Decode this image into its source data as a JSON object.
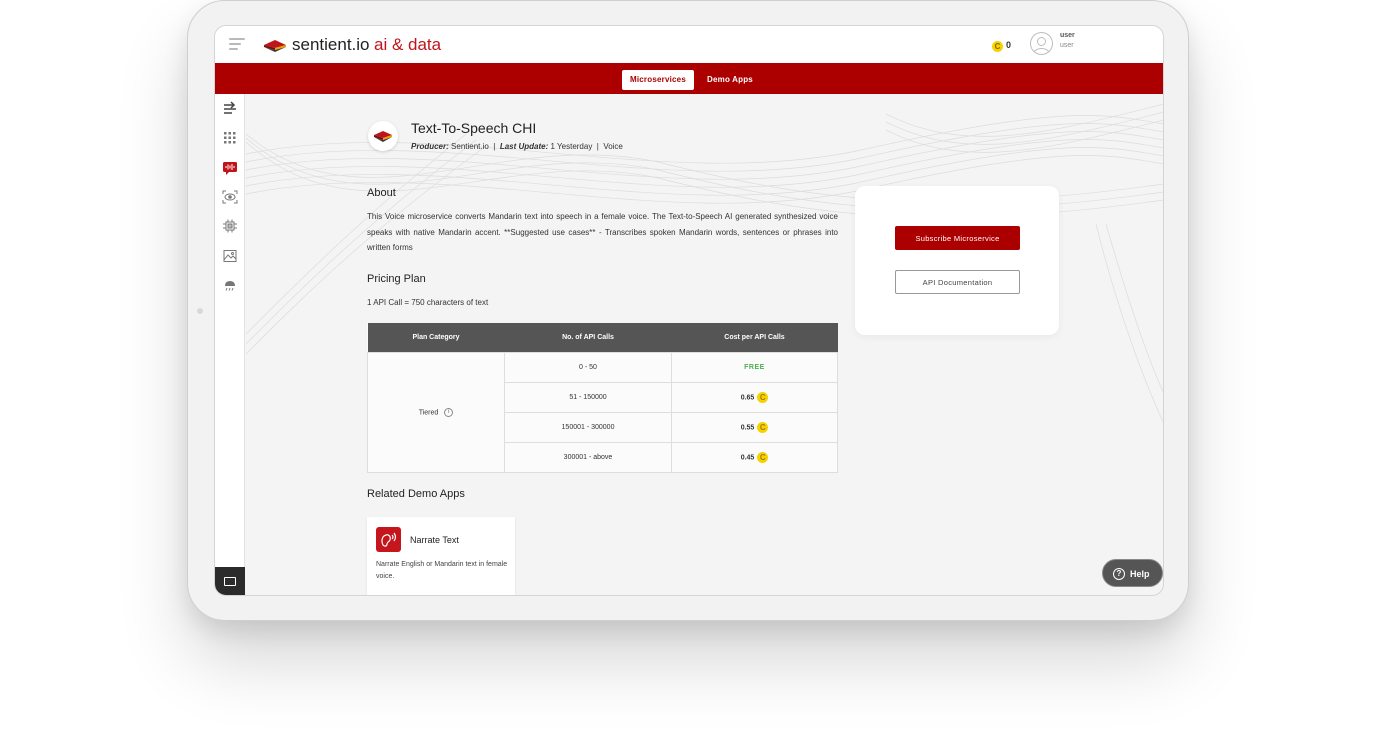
{
  "header": {
    "brand": "sentient.io",
    "brand_accent": "ai & data",
    "coin_balance": "0",
    "user_name": "user",
    "user_role": "user"
  },
  "nav": {
    "tabs": [
      {
        "label": "Microservices",
        "active": true
      },
      {
        "label": "Demo Apps",
        "active": false
      }
    ]
  },
  "sidebar": {
    "icons": [
      "collapse-arrow-icon",
      "grid-icon",
      "voice-icon",
      "vision-icon",
      "chip-icon",
      "image-icon",
      "weather-icon"
    ],
    "bottom_icon": "folder-icon"
  },
  "service": {
    "title": "Text-To-Speech CHI",
    "producer_label": "Producer:",
    "producer": "Sentient.io",
    "last_update_label": "Last Update:",
    "last_update": "1 Yesterday",
    "separator": "|",
    "category": "Voice"
  },
  "about": {
    "heading": "About",
    "text": "This Voice microservice converts Mandarin text into speech in a female voice. The Text-to-Speech AI generated synthesized voice speaks with native Mandarin accent. **Suggested use cases** - Transcribes spoken Mandarin words, sentences or phrases into written forms"
  },
  "pricing": {
    "heading": "Pricing Plan",
    "note": "1 API Call = 750 characters of text",
    "headers": [
      "Plan Category",
      "No. of API Calls",
      "Cost per API Calls"
    ],
    "category": "Tiered",
    "rows": [
      {
        "range": "0 - 50",
        "cost": "FREE",
        "coin": false
      },
      {
        "range": "51 - 150000",
        "cost": "0.65",
        "coin": true
      },
      {
        "range": "150001 - 300000",
        "cost": "0.55",
        "coin": true
      },
      {
        "range": "300001 - above",
        "cost": "0.45",
        "coin": true
      }
    ]
  },
  "related": {
    "heading": "Related Demo Apps",
    "apps": [
      {
        "title": "Narrate Text",
        "description": "Narrate English or Mandarin text in female voice."
      }
    ]
  },
  "actions": {
    "subscribe_label": "Subscribe Microservice",
    "docs_label": "API Documentation"
  },
  "help": {
    "label": "Help"
  },
  "colors": {
    "brand_red": "#ac0000",
    "accent_red": "#c0141b",
    "free_green": "#4caf50",
    "coin_yellow": "#f5d200"
  }
}
